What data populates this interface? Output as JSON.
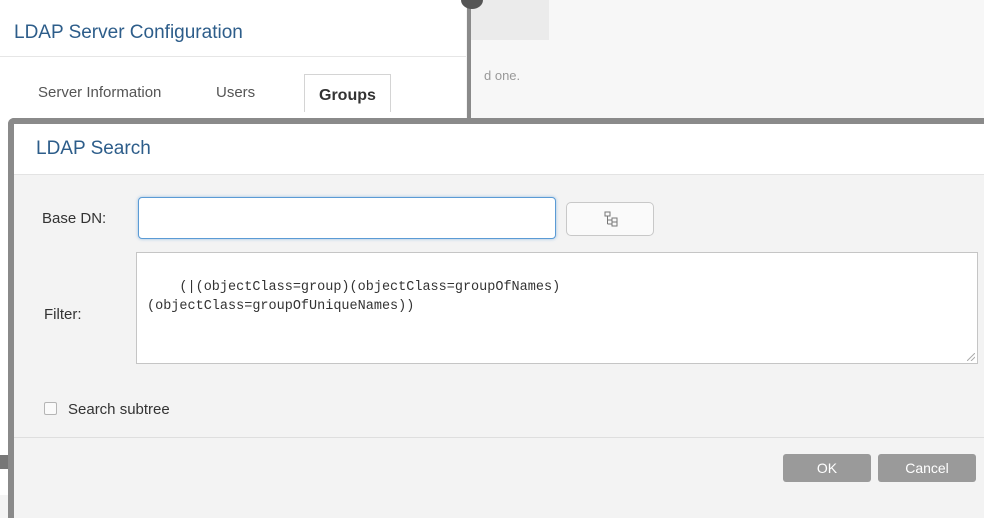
{
  "background": {
    "hint_text": "d one."
  },
  "parent_dialog": {
    "title": "LDAP Server Configuration",
    "tabs": [
      {
        "label": "Server Information",
        "active": false
      },
      {
        "label": "Users",
        "active": false
      },
      {
        "label": "Groups",
        "active": true
      }
    ]
  },
  "search_dialog": {
    "title": "LDAP Search",
    "base_dn": {
      "label": "Base DN:",
      "value": ""
    },
    "browse_button": {
      "icon": "tree-browse-icon"
    },
    "filter": {
      "label": "Filter:",
      "value": "(|(objectClass=group)(objectClass=groupOfNames)\n(objectClass=groupOfUniqueNames))"
    },
    "search_subtree": {
      "label": "Search subtree",
      "checked": false
    },
    "buttons": {
      "ok": "OK",
      "cancel": "Cancel"
    }
  },
  "colors": {
    "title": "#2d5d8a",
    "input_focus": "#5b9bd5",
    "button": "#9a9a9a",
    "border_dark": "#8a8a8a"
  }
}
